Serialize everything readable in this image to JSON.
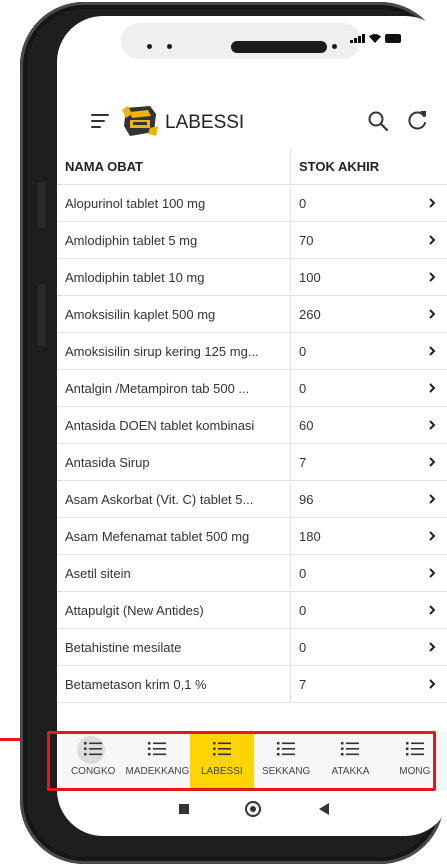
{
  "app": {
    "title": "LABESSI"
  },
  "icons": {
    "menu": "hamburger-icon",
    "logo": "app-logo",
    "search": "search-icon",
    "refresh": "refresh-icon",
    "row_action": "chevron-right-icon",
    "nav": "list-icon"
  },
  "table": {
    "headers": [
      "NAMA OBAT",
      "STOK AKHIR"
    ],
    "rows": [
      {
        "name": "Alopurinol tablet 100 mg",
        "stock": "0"
      },
      {
        "name": "Amlodiphin tablet 5 mg",
        "stock": "70"
      },
      {
        "name": "Amlodiphin tablet 10 mg",
        "stock": "100"
      },
      {
        "name": "Amoksisilin kaplet 500 mg",
        "stock": "260"
      },
      {
        "name": "Amoksisilin sirup kering 125 mg...",
        "stock": "0"
      },
      {
        "name": "Antalgin /Metampiron tab 500 ...",
        "stock": "0"
      },
      {
        "name": "Antasida DOEN tablet kombinasi",
        "stock": "60"
      },
      {
        "name": "Antasida Sirup",
        "stock": "7"
      },
      {
        "name": "Asam Askorbat (Vit. C) tablet 5...",
        "stock": "96"
      },
      {
        "name": "Asam Mefenamat tablet 500 mg",
        "stock": "180"
      },
      {
        "name": "Asetil sitein",
        "stock": "0"
      },
      {
        "name": "Attapulgit (New Antides)",
        "stock": "0"
      },
      {
        "name": "Betahistine mesilate",
        "stock": "0"
      },
      {
        "name": "Betametason krim 0,1 %",
        "stock": "7"
      }
    ]
  },
  "bottom_nav": {
    "items": [
      "CONGKO",
      "MADEKKANG",
      "LABESSI",
      "SEKKANG",
      "ATAKKA",
      "MONG"
    ],
    "active": "LABESSI"
  },
  "colors": {
    "active_tab": "#ffd400",
    "highlight_annotation": "#e5171c",
    "phone_frame": "#1e1e1e"
  }
}
